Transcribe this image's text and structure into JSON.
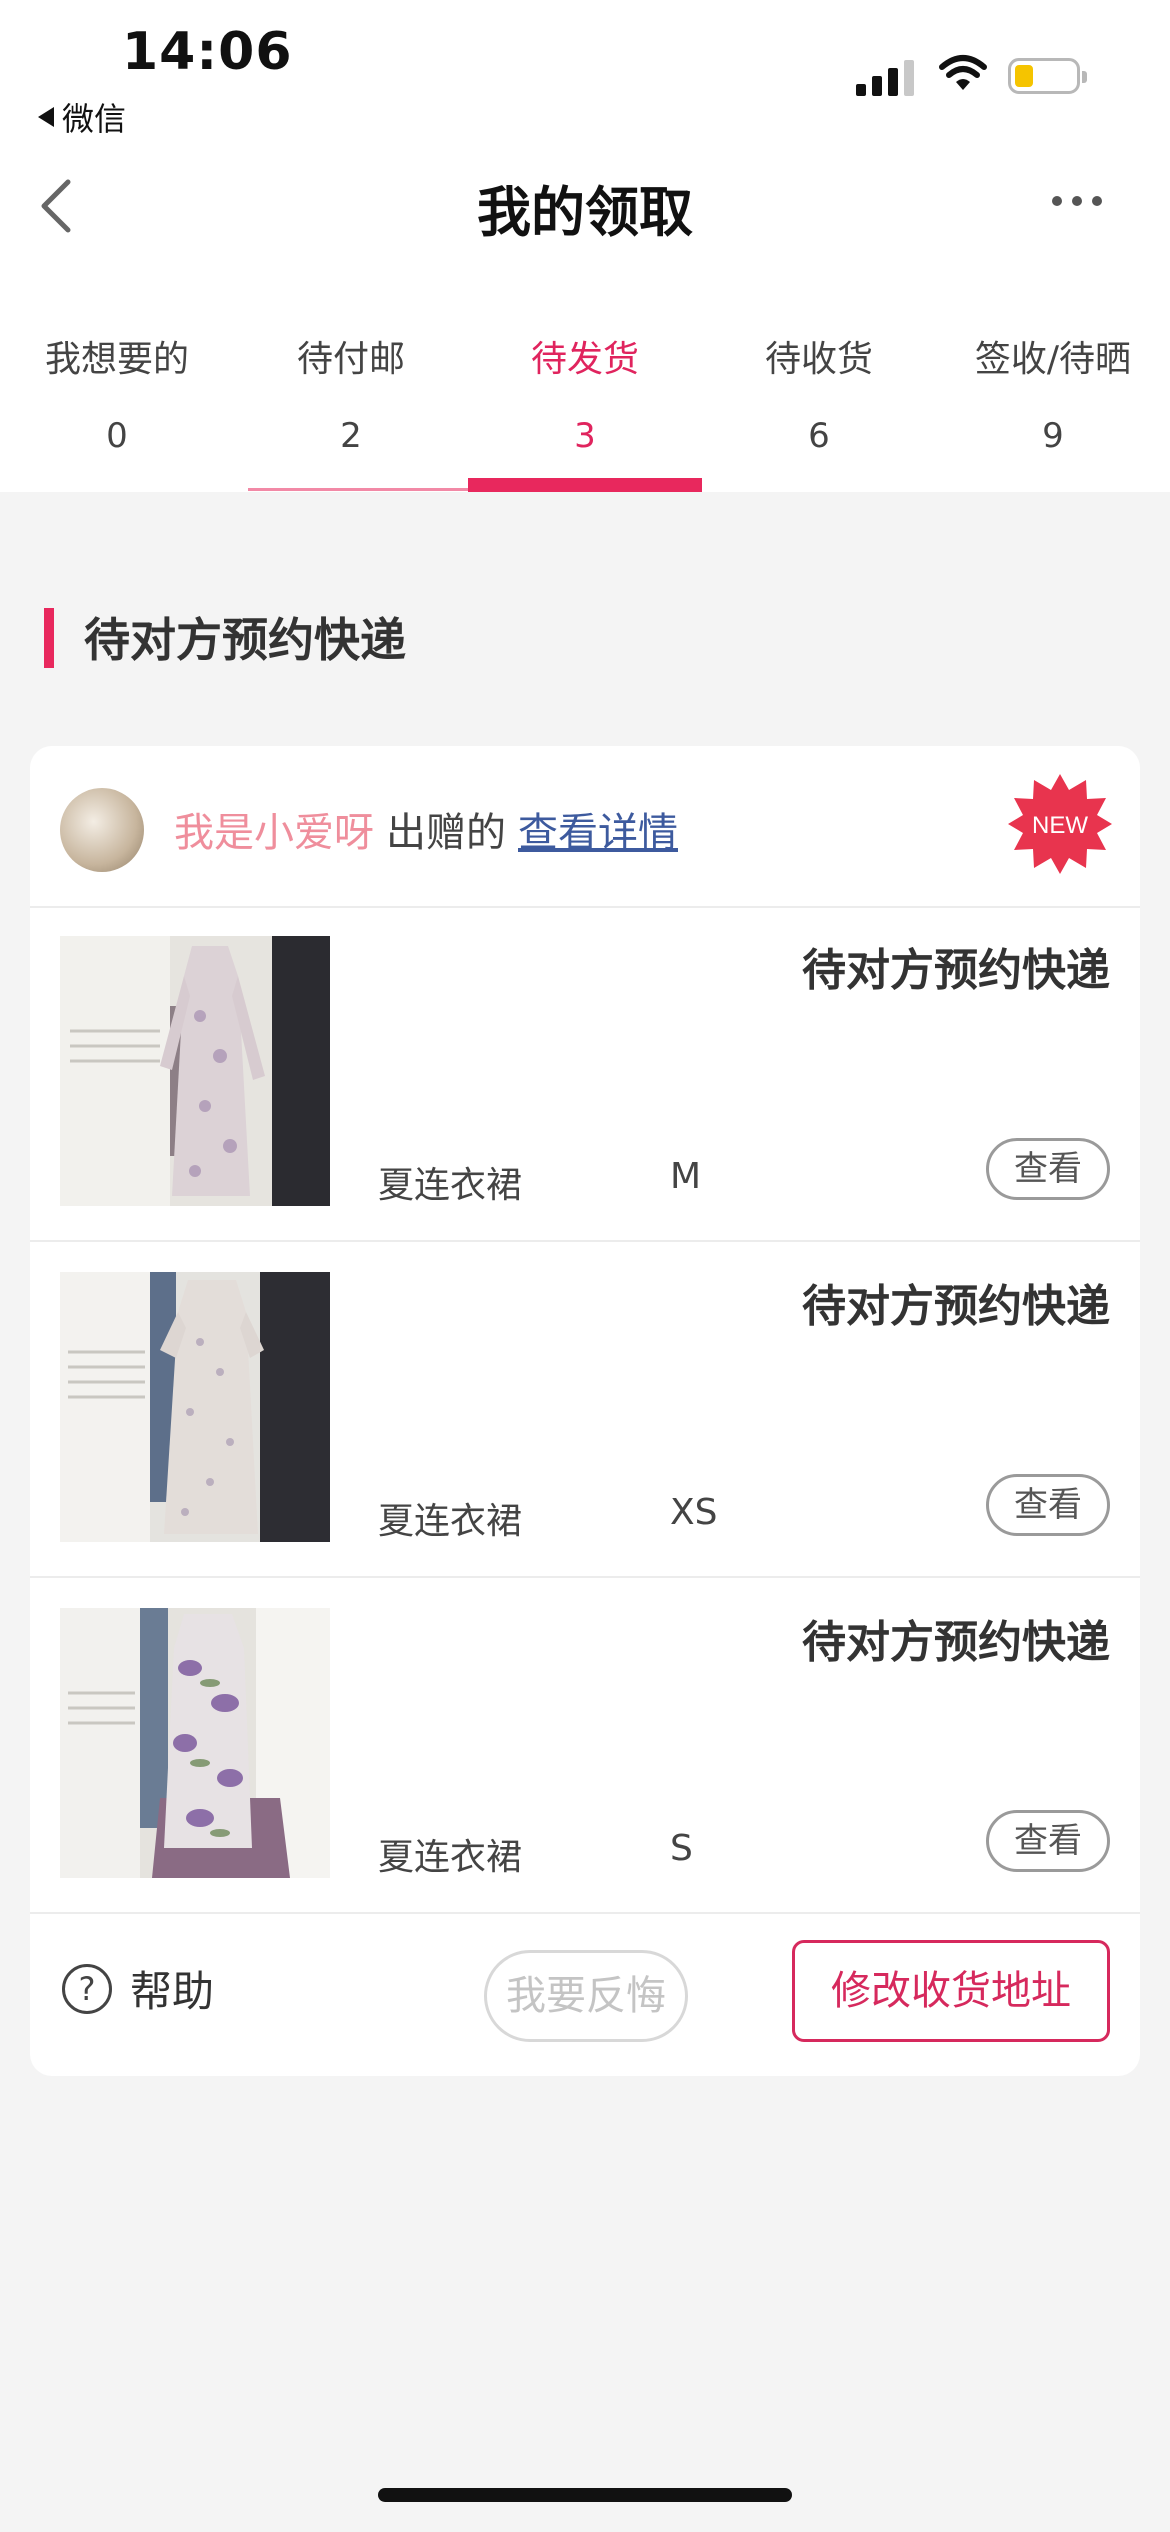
{
  "status_bar": {
    "time": "14:06",
    "back_app": "微信"
  },
  "nav": {
    "title": "我的领取"
  },
  "tabs": [
    {
      "label": "我想要的",
      "count": "0"
    },
    {
      "label": "待付邮",
      "count": "2"
    },
    {
      "label": "待发货",
      "count": "3"
    },
    {
      "label": "待收货",
      "count": "6"
    },
    {
      "label": "签收/待晒",
      "count": "9"
    }
  ],
  "active_tab": "待发货",
  "section": {
    "title": "待对方预约快递"
  },
  "card": {
    "giver_name": "我是小爱呀",
    "giver_verb": "出赠的",
    "detail_link": "查看详情",
    "badge": "NEW",
    "items": [
      {
        "status": "待对方预约快递",
        "name": "夏连衣裙",
        "size": "M",
        "button": "查看"
      },
      {
        "status": "待对方预约快递",
        "name": "夏连衣裙",
        "size": "XS",
        "button": "查看"
      },
      {
        "status": "待对方预约快递",
        "name": "夏连衣裙",
        "size": "S",
        "button": "查看"
      }
    ],
    "footer": {
      "help": "帮助",
      "regret": "我要反悔",
      "change_address": "修改收货地址"
    }
  },
  "colors": {
    "accent": "#e8285d",
    "giver_name": "#ef8e9c",
    "link": "#3d5a9e",
    "badge": "#e8344e"
  }
}
